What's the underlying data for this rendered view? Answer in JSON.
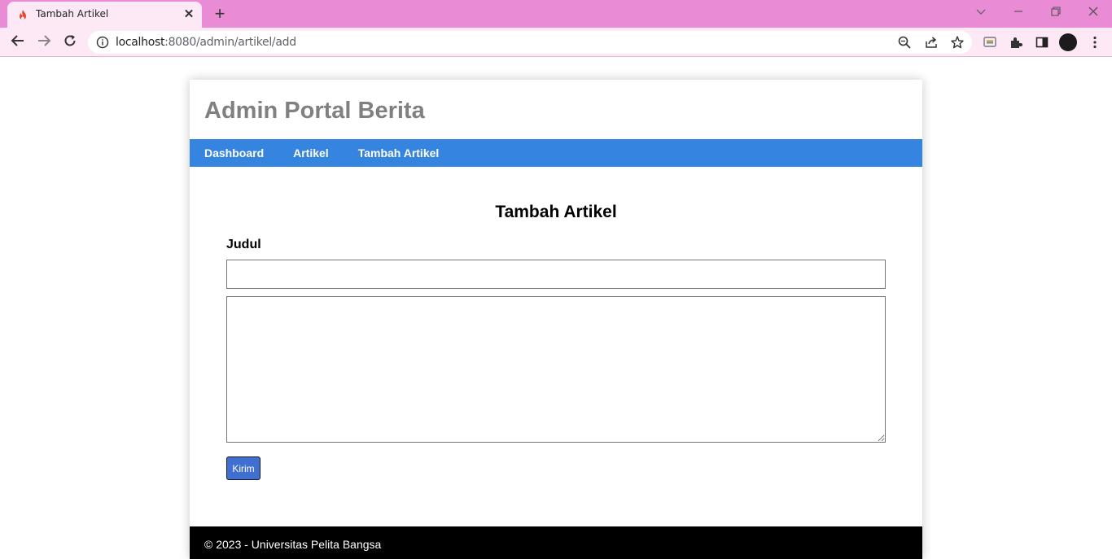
{
  "browser": {
    "tab_title": "Tambah Artikel",
    "url_host": "localhost",
    "url_path": ":8080/admin/artikel/add"
  },
  "icons": {
    "favicon": "flame-icon",
    "back": "arrow-left-icon",
    "forward": "arrow-right-icon",
    "reload": "reload-icon",
    "site_info": "info-icon",
    "zoom": "zoom-icon",
    "share": "share-icon",
    "bookmark": "star-icon"
  },
  "site": {
    "title": "Admin Portal Berita",
    "nav": [
      {
        "label": "Dashboard"
      },
      {
        "label": "Artikel"
      },
      {
        "label": "Tambah Artikel"
      }
    ]
  },
  "form": {
    "heading": "Tambah Artikel",
    "title_label": "Judul",
    "title_value": "",
    "content_value": "",
    "submit_label": "Kirim"
  },
  "footer": {
    "text": "© 2023 - Universitas Pelita Bangsa"
  },
  "colors": {
    "tabbar": "#ea8bd6",
    "toolbar": "#fde8f6",
    "nav_bar": "#3584e0",
    "submit": "#3f6fd0",
    "footer": "#000000",
    "site_title": "#808080"
  }
}
